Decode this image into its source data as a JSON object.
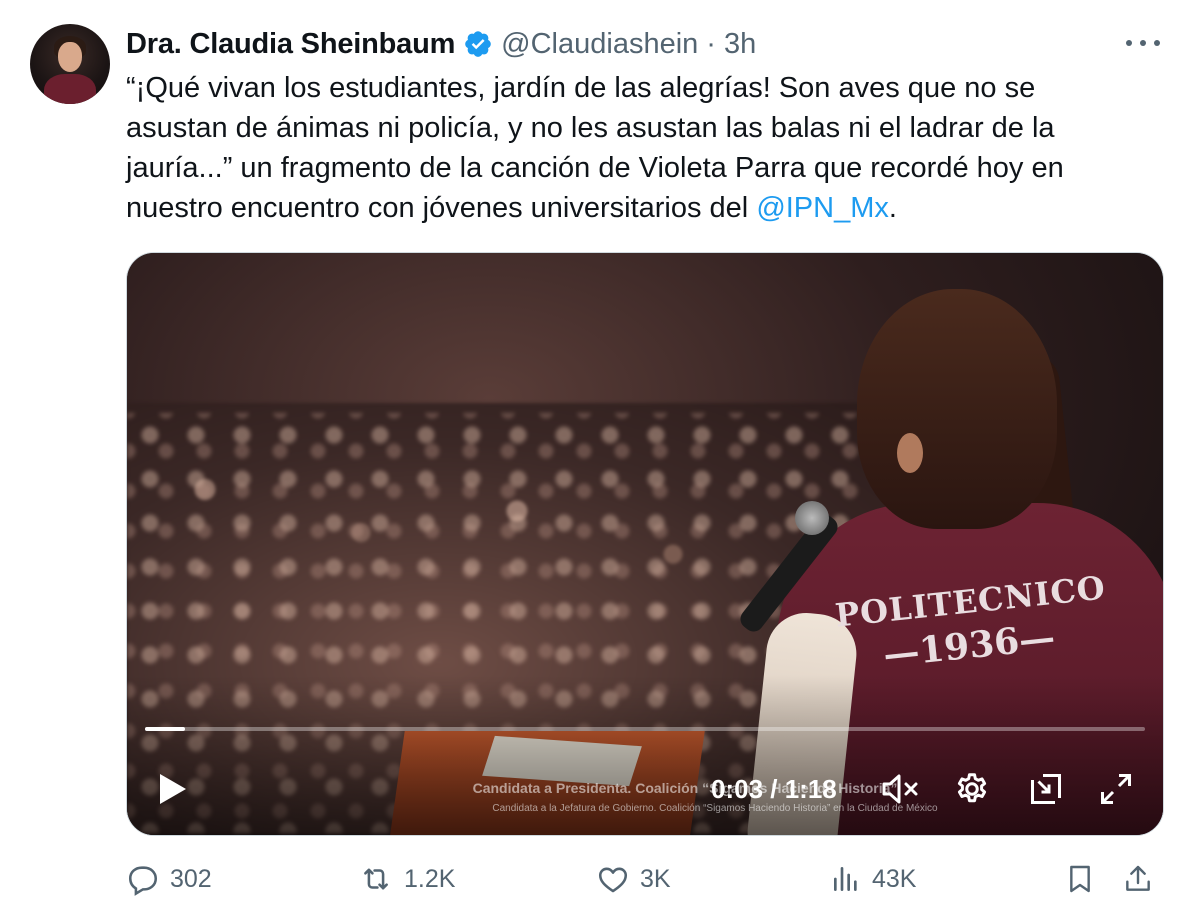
{
  "author": {
    "display_name": "Dra. Claudia Sheinbaum",
    "handle": "@Claudiashein",
    "separator": "·",
    "time": "3h",
    "verified": true
  },
  "tweet": {
    "text_main": "“¡Qué vivan los estudiantes, jardín de las alegrías! Son aves que no se\nasustan de ánimas ni policía, y no les asustan las balas ni el ladrar de la\njauría...” un fragmento de la canción de Violeta Parra que recordé hoy en\nnuestro encuentro con jóvenes universitarios del ",
    "mention": "@IPN_Mx",
    "text_end": "."
  },
  "media": {
    "jacket_line1": "POLITECNICO",
    "jacket_line2": "—1936—",
    "caption_line1": "Candidata a Presidenta. Coalición “Sigamos Haciendo Historia”",
    "caption_line2": "Candidata a la Jefatura de Gobierno. Coalición “Sigamos Haciendo Historia” en la Ciudad de México",
    "timer": "0:03 / 1:18",
    "progress": 0.04,
    "icons": [
      "play-icon",
      "volume-muted-icon",
      "settings-gear-icon",
      "picture-in-picture-icon",
      "fullscreen-icon"
    ]
  },
  "actions": {
    "replies": "302",
    "reposts": "1.2K",
    "likes": "3K",
    "views": "43K"
  },
  "colors": {
    "text": "#0f1419",
    "secondary": "#536471",
    "link": "#1d9bf0",
    "verified": "#1d9bf0"
  }
}
